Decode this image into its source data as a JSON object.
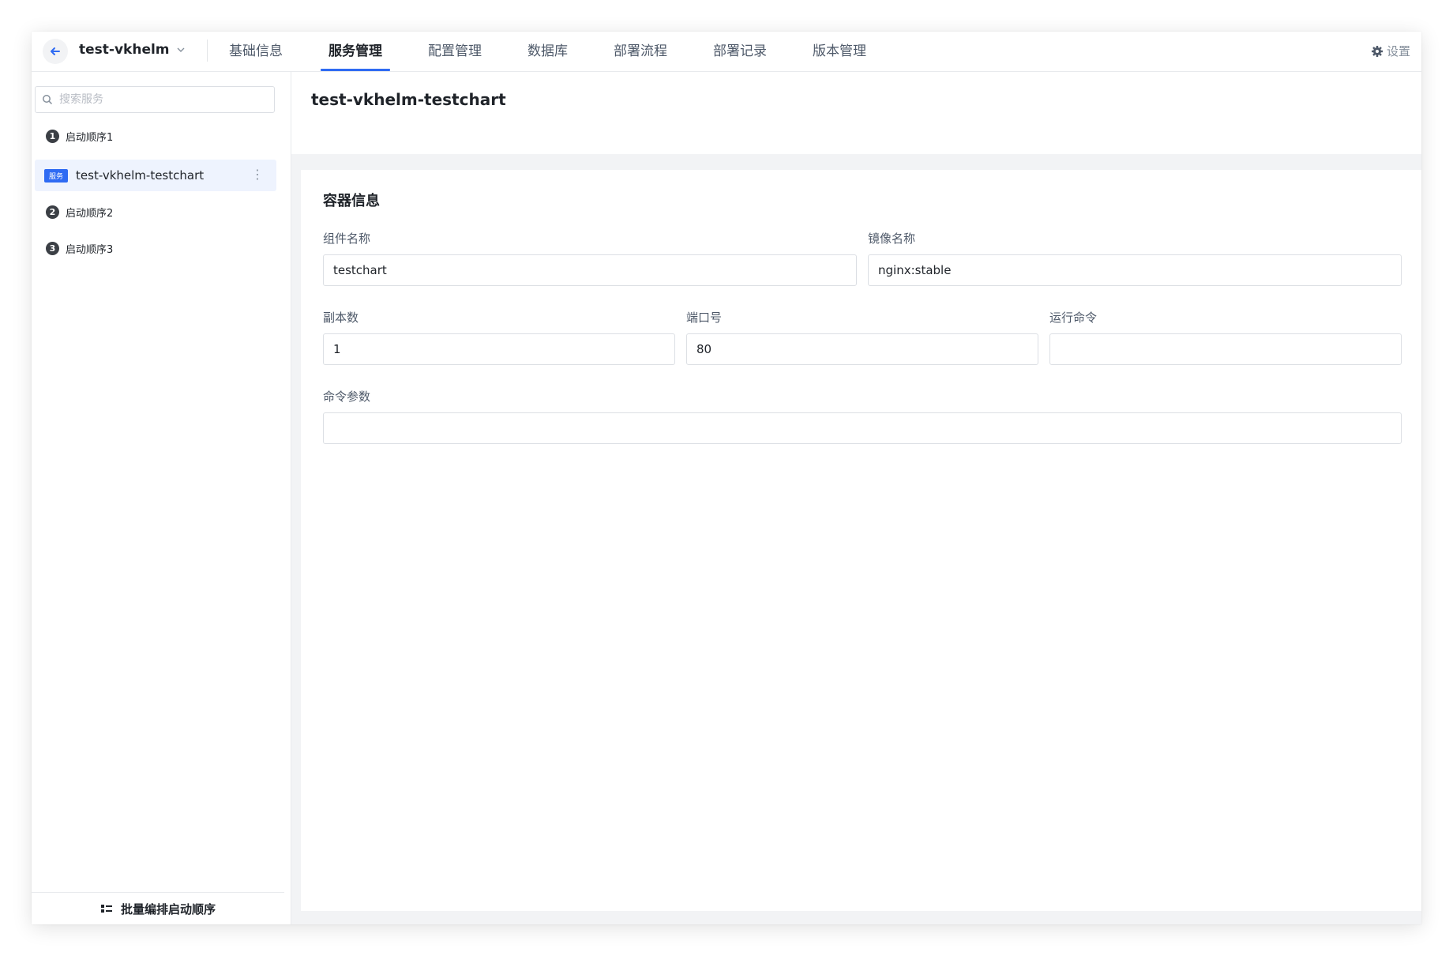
{
  "topbar": {
    "project_name": "test-vkhelm",
    "tabs": [
      "基础信息",
      "服务管理",
      "配置管理",
      "数据库",
      "部署流程",
      "部署记录",
      "版本管理"
    ],
    "active_tab": "服务管理",
    "settings_label": "设置",
    "accent_color": "#2f6bf3"
  },
  "sidebar": {
    "search_placeholder": "搜索服务",
    "groups": [
      {
        "index": "1",
        "label": "启动顺序1"
      },
      {
        "index": "2",
        "label": "启动顺序2"
      },
      {
        "index": "3",
        "label": "启动顺序3"
      }
    ],
    "service": {
      "tag": "服务",
      "name": "test-vkhelm-testchart"
    },
    "footer_label": "批量编排启动顺序"
  },
  "main": {
    "title": "test-vkhelm-testchart",
    "section_title": "容器信息",
    "fields": {
      "component_name": {
        "label": "组件名称",
        "value": "testchart"
      },
      "image_name": {
        "label": "镜像名称",
        "value": "nginx:stable"
      },
      "replicas": {
        "label": "副本数",
        "value": "1"
      },
      "port": {
        "label": "端口号",
        "value": "80"
      },
      "run_command": {
        "label": "运行命令",
        "value": ""
      },
      "command_args": {
        "label": "命令参数",
        "value": ""
      }
    }
  }
}
